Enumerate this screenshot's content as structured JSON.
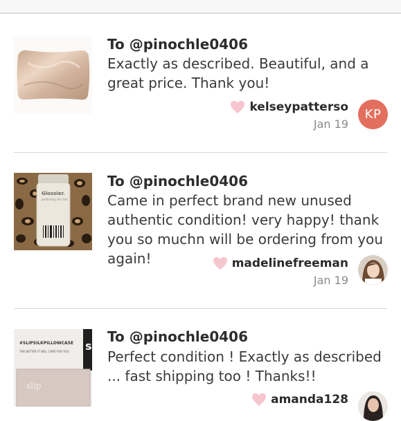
{
  "reviews": [
    {
      "to": "To @pinochle0406",
      "comment": "Exactly as described. Beautiful, and a great price. Thank you!",
      "username": "kelseypatterso",
      "date": "Jan 19",
      "avatar_initials": "KP",
      "avatar_color": "#e36f5e"
    },
    {
      "to": "To @pinochle0406",
      "comment": "Came in perfect brand new unused authentic condition! very happy! thank you so muchn will be ordering from you again!",
      "username": "madelinefreeman",
      "date": "Jan 19"
    },
    {
      "to": "To @pinochle0406",
      "comment": "Perfect condition ! Exactly as described ... fast shipping too ! Thanks!!",
      "username": "amanda128"
    }
  ],
  "product_labels": {
    "glossier_brand": "Glossier.",
    "glossier_product": "perfecting skin tint",
    "slip_hashtag": "#SLIPSILKPILLOWCASE",
    "slip_tagline": "THE BETTER IT WILL CARE FOR YOU"
  },
  "colors": {
    "heart": "#f6c6cf",
    "divider": "#d7d7d7",
    "date": "#8a8a8a"
  }
}
